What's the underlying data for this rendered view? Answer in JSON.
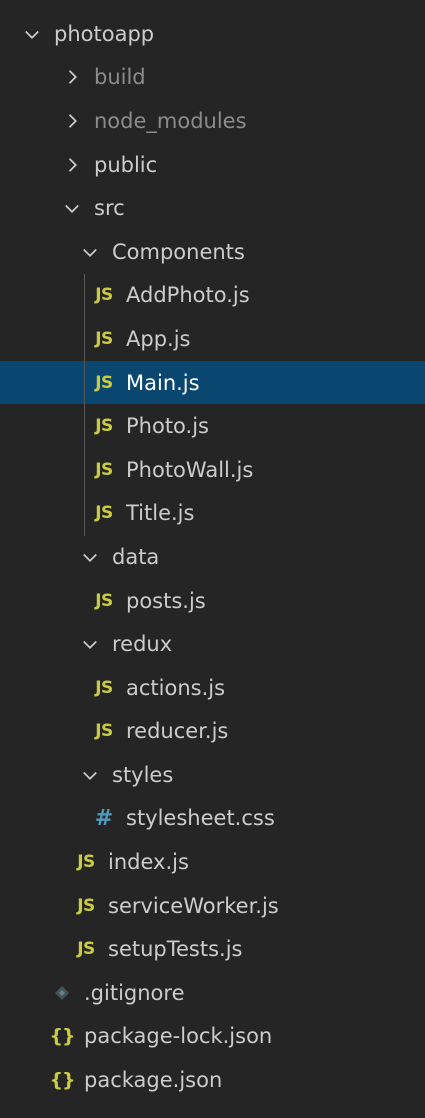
{
  "explorer": {
    "root": {
      "label": "photoapp"
    },
    "build": {
      "label": "build"
    },
    "node_modules": {
      "label": "node_modules"
    },
    "public": {
      "label": "public"
    },
    "src": {
      "label": "src"
    },
    "components": {
      "label": "Components",
      "files": [
        "AddPhoto.js",
        "App.js",
        "Main.js",
        "Photo.js",
        "PhotoWall.js",
        "Title.js"
      ]
    },
    "data_folder": {
      "label": "data",
      "files": [
        "posts.js"
      ]
    },
    "redux": {
      "label": "redux",
      "files": [
        "actions.js",
        "reducer.js"
      ]
    },
    "styles": {
      "label": "styles",
      "files": [
        "stylesheet.css"
      ]
    },
    "src_files": [
      "index.js",
      "serviceWorker.js",
      "setupTests.js"
    ],
    "root_files": [
      ".gitignore",
      "package-lock.json",
      "package.json"
    ],
    "selected_file": "Main.js",
    "icon_text": {
      "js": "JS",
      "css": "#",
      "json": "{}"
    },
    "colors": {
      "background": "#252526",
      "selection": "#094771",
      "js_icon": "#cbcb41",
      "css_icon": "#519aba",
      "text": "#cccccc",
      "dim_text": "#8c8c8c"
    }
  }
}
